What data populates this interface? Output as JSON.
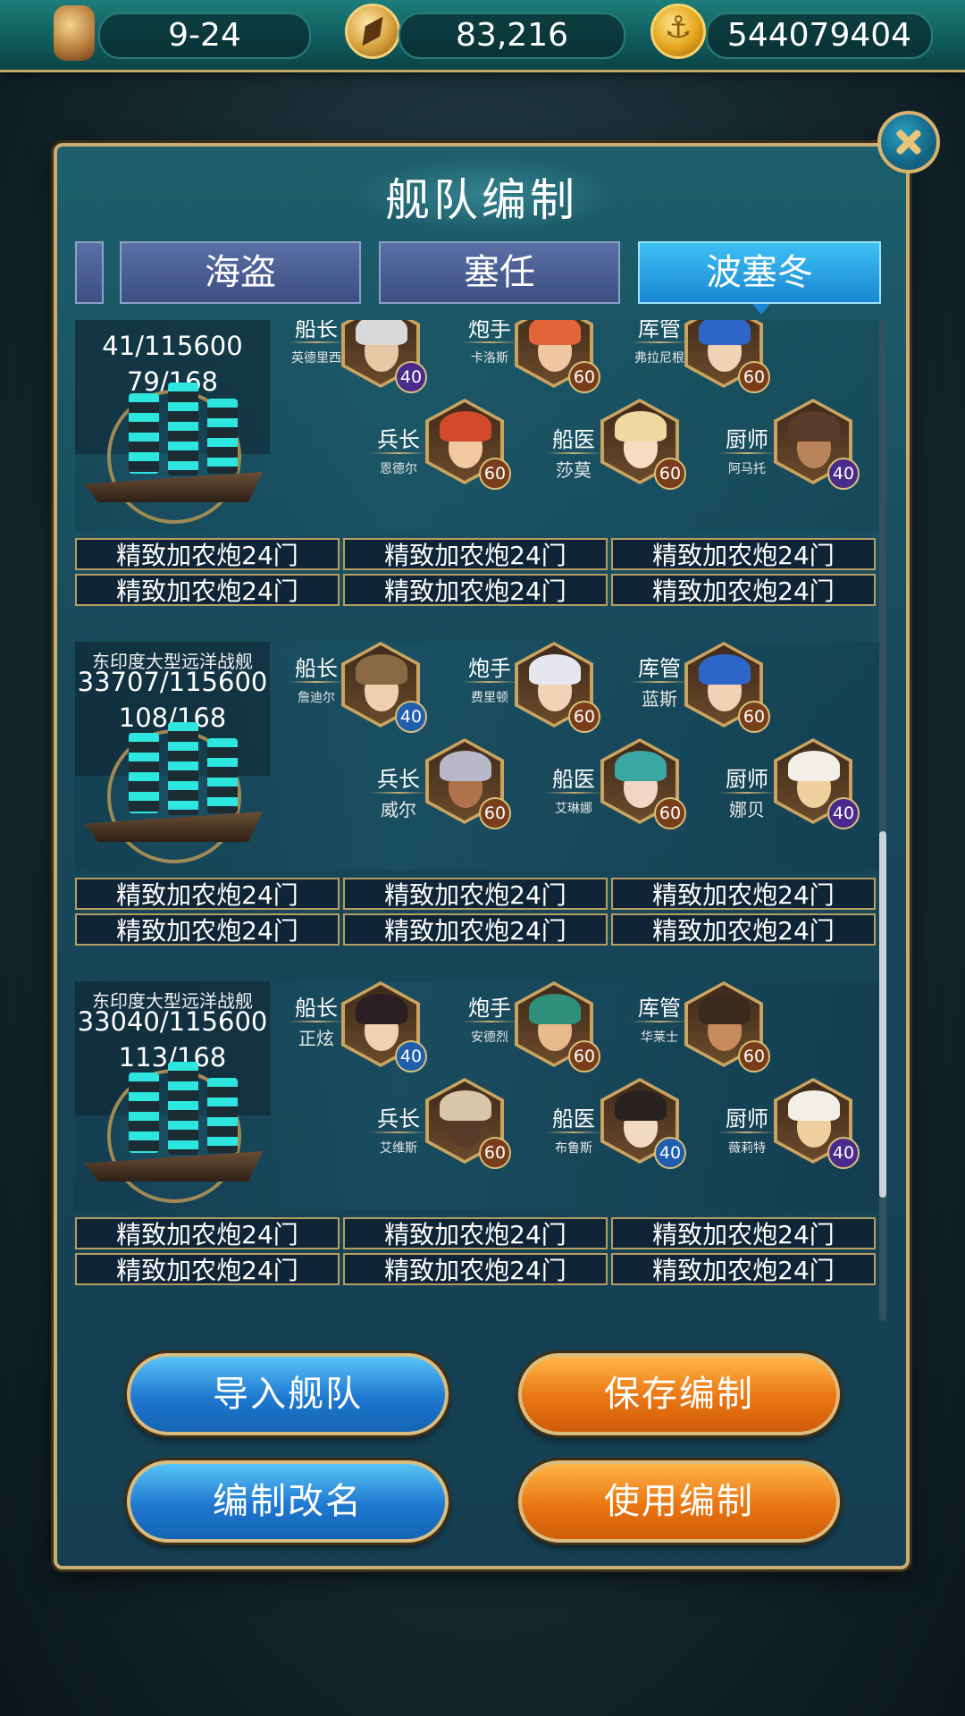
{
  "resources": [
    {
      "name": "hourglass-icon",
      "value": "9-24"
    },
    {
      "name": "compass-icon",
      "value": "83,216"
    },
    {
      "name": "anchor-coin-icon",
      "value": "544079404"
    }
  ],
  "dialog": {
    "title": "舰队编制",
    "tabs": [
      "海盗",
      "塞任",
      "波塞冬"
    ],
    "selected_tab": "波塞冬"
  },
  "fleets": [
    {
      "ship_name": "",
      "durability": "41/115600",
      "crew": "79/168",
      "members": [
        {
          "role": "船长",
          "name": "英德里西",
          "level": "40"
        },
        {
          "role": "炮手",
          "name": "卡洛斯",
          "level": "60"
        },
        {
          "role": "库管",
          "name": "弗拉尼根",
          "level": "60"
        },
        {
          "role": "兵长",
          "name": "恩德尔",
          "level": "60"
        },
        {
          "role": "船医",
          "name": "莎莫",
          "level": "60"
        },
        {
          "role": "厨师",
          "name": "阿马托",
          "level": "40"
        }
      ],
      "cannons": [
        "精致加农炮24门",
        "精致加农炮24门",
        "精致加农炮24门",
        "精致加农炮24门",
        "精致加农炮24门",
        "精致加农炮24门"
      ]
    },
    {
      "ship_name": "东印度大型远洋战舰",
      "durability": "33707/115600",
      "crew": "108/168",
      "members": [
        {
          "role": "船长",
          "name": "詹迪尔",
          "level": "40"
        },
        {
          "role": "炮手",
          "name": "费里顿",
          "level": "60"
        },
        {
          "role": "库管",
          "name": "蓝斯",
          "level": "60"
        },
        {
          "role": "兵长",
          "name": "威尔",
          "level": "60"
        },
        {
          "role": "船医",
          "name": "艾琳娜",
          "level": "60"
        },
        {
          "role": "厨师",
          "name": "娜贝",
          "level": "40"
        }
      ],
      "cannons": [
        "精致加农炮24门",
        "精致加农炮24门",
        "精致加农炮24门",
        "精致加农炮24门",
        "精致加农炮24门",
        "精致加农炮24门"
      ]
    },
    {
      "ship_name": "东印度大型远洋战舰",
      "durability": "33040/115600",
      "crew": "113/168",
      "members": [
        {
          "role": "船长",
          "name": "正炫",
          "level": "40"
        },
        {
          "role": "炮手",
          "name": "安德烈",
          "level": "60"
        },
        {
          "role": "库管",
          "name": "华莱士",
          "level": "60"
        },
        {
          "role": "兵长",
          "name": "艾维斯",
          "level": "60"
        },
        {
          "role": "船医",
          "name": "布鲁斯",
          "level": "40"
        },
        {
          "role": "厨师",
          "name": "薇莉特",
          "level": "40"
        }
      ],
      "cannons": [
        "精致加农炮24门",
        "精致加农炮24门",
        "精致加农炮24门",
        "精致加农炮24门",
        "精致加农炮24门",
        "精致加农炮24门"
      ]
    }
  ],
  "buttons": {
    "import": "导入舰队",
    "save": "保存编制",
    "rename": "编制改名",
    "use": "使用编制"
  },
  "colors": {
    "level_40": "#4a2a8a",
    "level_40_alt": "#1f5fae",
    "level_60": "#7a3d1a",
    "accent_gold": "#c9ad72",
    "selected_tab": "#1a86d3"
  }
}
